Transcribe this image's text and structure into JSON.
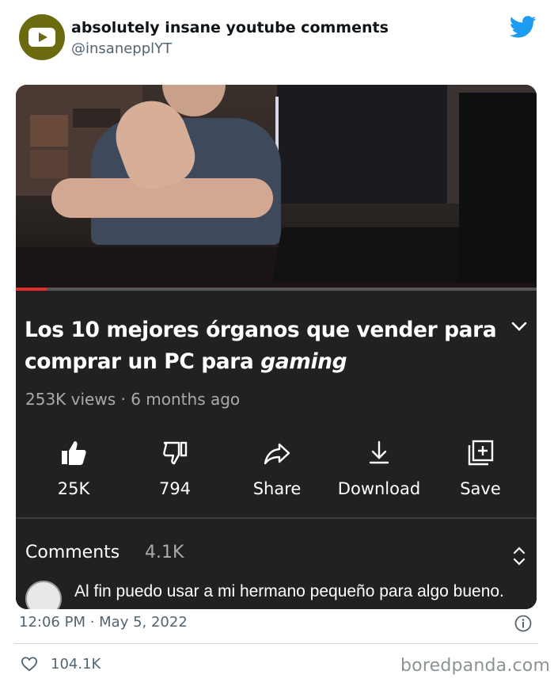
{
  "tweet": {
    "display_name": "absolutely insane youtube comments",
    "handle": "@insanepplYT",
    "timestamp": "12:06 PM · May 5, 2022",
    "likes": "104.1K",
    "avatar_color": "#6b6a0e",
    "brand_icon": "twitter-bird-icon",
    "brand_color": "#1d9bf0"
  },
  "video": {
    "title_main": "Los 10 mejores órganos que vender para comprar un PC para ",
    "title_italic": "gaming",
    "meta": "253K views · 6 months ago",
    "progress": 0.06,
    "actions": [
      {
        "label": "25K",
        "icon": "thumbs-up-icon"
      },
      {
        "label": "794",
        "icon": "thumbs-down-icon"
      },
      {
        "label": "Share",
        "icon": "share-icon"
      },
      {
        "label": "Download",
        "icon": "download-icon"
      },
      {
        "label": "Save",
        "icon": "save-icon"
      }
    ],
    "comments_label": "Comments",
    "comments_count": "4.1K",
    "top_comment": "Al fin puedo usar a mi hermano pequeño para algo bueno."
  },
  "watermark": "boredpanda.com"
}
